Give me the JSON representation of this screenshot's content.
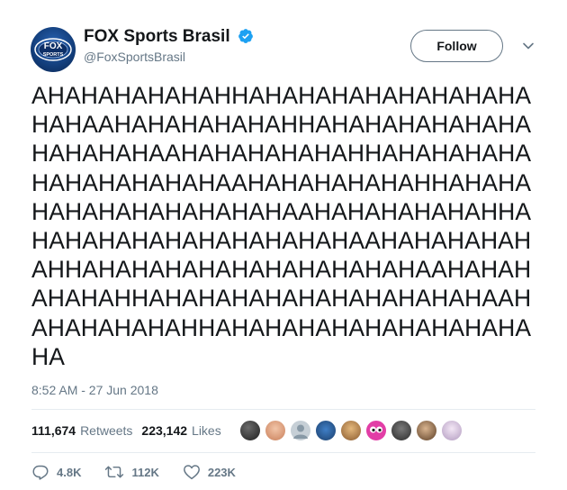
{
  "header": {
    "display_name": "FOX Sports Brasil",
    "handle": "@FoxSportsBrasil",
    "follow_label": "Follow",
    "avatar_logo_text": "FOX SPORTS",
    "verified_icon": "verified-badge-icon",
    "menu_icon": "chevron-down-icon"
  },
  "tweet": {
    "lines": [
      "AHAHAHAHAHAHHAHAHAHAHAHAHAHAHA",
      "HAHAAHAHAHAHAHAHHAHAHAHAHAHAHA",
      "HAHAHAHAAHAHAHAHAHAHHAHAHAHAHA",
      "HAHAHAHAHAHAAHAHAHAHAHAHHAHAHA",
      "HAHAHAHAHAHAHAHAAHAHAHAHAHAHHA",
      "HAHAHAHAHAHAHAHAHAHAAHAHAHAHAH",
      "AHHAHAHAHAHAHAHAHAHAHAHAAHAHAH",
      "AHAHAHHAHAHAHAHAHAHAHAHAHAHAAH",
      "AHAHAHAHAHHAHAHAHAHAHAHAHAHAHA",
      "HA"
    ],
    "timestamp": "8:52 AM - 27 Jun 2018"
  },
  "stats": {
    "retweets_count": "111,674",
    "retweets_label": "Retweets",
    "likes_count": "223,142",
    "likes_label": "Likes"
  },
  "actions": {
    "reply_count": "4.8K",
    "retweet_count": "112K",
    "like_count": "223K"
  },
  "colors": {
    "text": "#14171a",
    "secondary": "#657786",
    "verified": "#1da1f2",
    "divider": "#e6ecf0"
  }
}
